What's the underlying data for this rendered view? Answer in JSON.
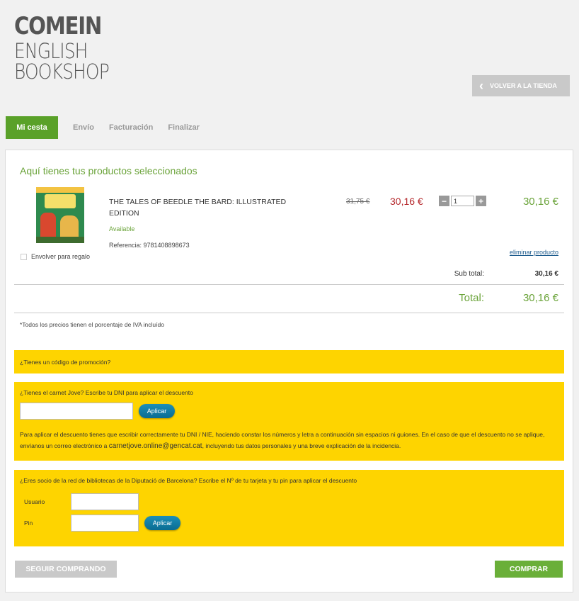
{
  "logo": {
    "line1": "COMEIN",
    "line2": "ENGLISH",
    "line3": "BOOKSHOP"
  },
  "header": {
    "back_label": "VOLVER A LA TIENDA"
  },
  "tabs": [
    {
      "label": "Mi cesta",
      "active": true
    },
    {
      "label": "Envío",
      "active": false
    },
    {
      "label": "Facturación",
      "active": false
    },
    {
      "label": "Finalizar",
      "active": false
    }
  ],
  "cart": {
    "heading": "Aquí tienes tus productos seleccionados",
    "item": {
      "title": "THE TALES OF BEEDLE THE BARD: ILLUSTRATED EDITION",
      "availability": "Available",
      "reference": "Referencia: 9781408898673",
      "old_price": "31,75 €",
      "price": "30,16 €",
      "quantity": "1",
      "line_total": "30,16 €",
      "remove_label": "eliminar producto",
      "gift_label": "Envolver para regalo"
    },
    "subtotal_label": "Sub total:",
    "subtotal_value": "30,16 €",
    "total_label": "Total:",
    "total_value": "30,16 €",
    "iva_note": "*Todos los precios tienen el porcentaje de IVA incluído"
  },
  "promo": {
    "label": "¿Tienes un código de promoción?"
  },
  "jove": {
    "label": "¿Tienes el carnet Jove? Escribe tu DNI para aplicar el descuento",
    "apply_label": "Aplicar",
    "para_pre": "Para aplicar el descuento tienes que escribir correctamente tu DNI / NIE, haciendo constar los números y letra a continuación sin espacios ni guiones. En el caso de que el descuento no se aplique, envíanos un correo electrónico a ",
    "email": "carnetjove.online@gencat.cat",
    "para_post": ", incluyendo tus datos personales y una breve explicación de la incidencia."
  },
  "diputacio": {
    "label": "¿Eres socio de la red de bibliotecas de la Diputació de Barcelona? Escribe el Nº de tu tarjeta y tu pin para aplicar el descuento",
    "user_label": "Usuario",
    "pin_label": "Pin",
    "apply_label": "Aplicar"
  },
  "actions": {
    "continue_label": "SEGUIR COMPRANDO",
    "buy_label": "COMPRAR"
  },
  "colors": {
    "accent_green": "#5aa129",
    "price_red": "#b4262a",
    "yellow": "#fed400",
    "link_blue": "#1b5a8c"
  }
}
